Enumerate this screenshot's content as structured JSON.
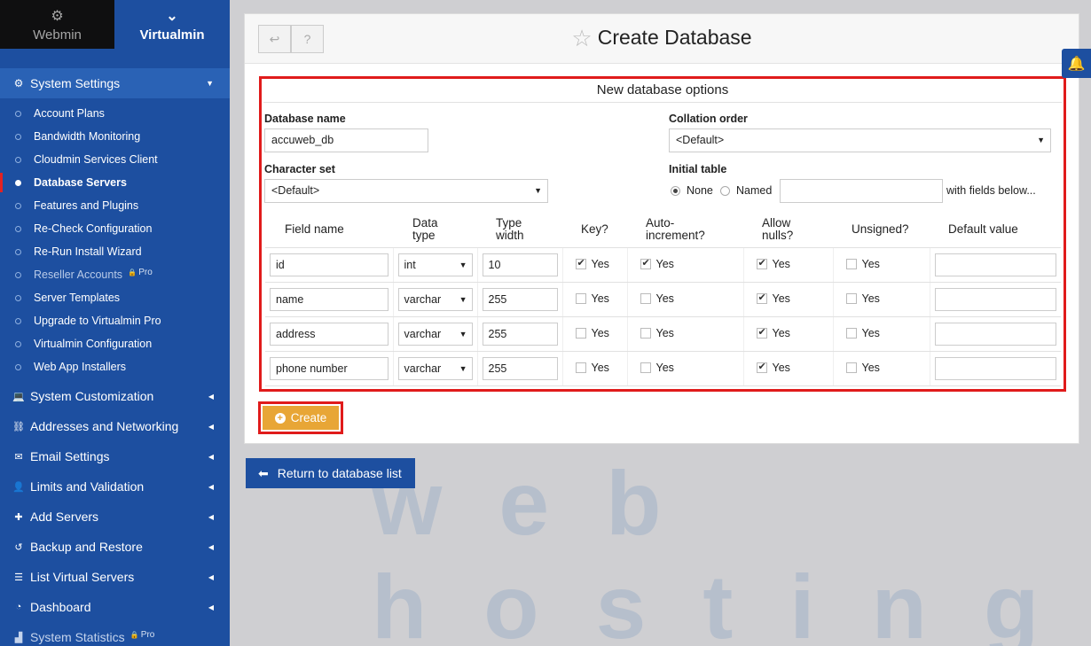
{
  "sidebar": {
    "tabs": [
      {
        "label": "Webmin",
        "icon": "webmin-icon"
      },
      {
        "label": "Virtualmin",
        "icon": "chevron-down-icon"
      }
    ],
    "open_section": {
      "label": "System Settings",
      "icon": "gear-icon"
    },
    "sub_items": [
      {
        "label": "Account Plans"
      },
      {
        "label": "Bandwidth Monitoring"
      },
      {
        "label": "Cloudmin Services Client"
      },
      {
        "label": "Database Servers",
        "active": true
      },
      {
        "label": "Features and Plugins"
      },
      {
        "label": "Re-Check Configuration"
      },
      {
        "label": "Re-Run Install Wizard"
      },
      {
        "label": "Reseller Accounts",
        "pro": "Pro"
      },
      {
        "label": "Server Templates"
      },
      {
        "label": "Upgrade to Virtualmin Pro"
      },
      {
        "label": "Virtualmin Configuration"
      },
      {
        "label": "Web App Installers"
      }
    ],
    "sections": [
      {
        "label": "System Customization",
        "icon": "laptop-icon"
      },
      {
        "label": "Addresses and Networking",
        "icon": "network-icon"
      },
      {
        "label": "Email Settings",
        "icon": "envelope-icon"
      },
      {
        "label": "Limits and Validation",
        "icon": "user-lock-icon"
      },
      {
        "label": "Add Servers",
        "icon": "plus-icon"
      },
      {
        "label": "Backup and Restore",
        "icon": "history-icon"
      },
      {
        "label": "List Virtual Servers",
        "icon": "list-icon"
      },
      {
        "label": "Dashboard",
        "icon": "dashboard-icon"
      },
      {
        "label": "System Statistics",
        "icon": "chart-icon",
        "pro": "Pro"
      }
    ]
  },
  "header": {
    "title": "Create Database"
  },
  "form": {
    "section_title": "New database options",
    "db_name_label": "Database name",
    "db_name_value": "accuweb_db",
    "collation_label": "Collation order",
    "collation_value": "<Default>",
    "charset_label": "Character set",
    "charset_value": "<Default>",
    "initial_table_label": "Initial table",
    "radio_none": "None",
    "radio_named": "Named",
    "with_fields": "with fields below...",
    "columns": [
      "Field name",
      "Data type",
      "Type width",
      "Key?",
      "Auto-increment?",
      "Allow nulls?",
      "Unsigned?",
      "Default value"
    ],
    "col_datatype": [
      "Data",
      "type"
    ],
    "col_typewidth": [
      "Type",
      "width"
    ],
    "col_auto": [
      "Auto-",
      "increment?"
    ],
    "col_nulls": [
      "Allow",
      "nulls?"
    ],
    "yes": "Yes",
    "rows": [
      {
        "name": "id",
        "type": "int",
        "width": "10",
        "key": true,
        "auto": true,
        "nulls": true,
        "unsigned": false
      },
      {
        "name": "name",
        "type": "varchar",
        "width": "255",
        "key": false,
        "auto": false,
        "nulls": true,
        "unsigned": false
      },
      {
        "name": "address",
        "type": "varchar",
        "width": "255",
        "key": false,
        "auto": false,
        "nulls": true,
        "unsigned": false
      },
      {
        "name": "phone number",
        "type": "varchar",
        "width": "255",
        "key": false,
        "auto": false,
        "nulls": true,
        "unsigned": false
      }
    ],
    "create_label": "Create"
  },
  "return_label": "Return to database list",
  "watermark": "web hosting"
}
